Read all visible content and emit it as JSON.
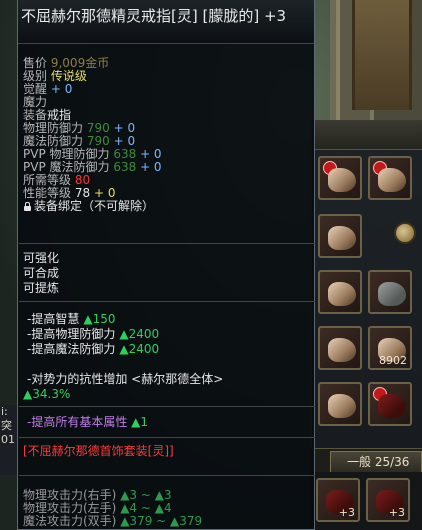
{
  "background": {
    "left_strip_text": [
      "i:",
      "突",
      "01"
    ]
  },
  "tooltip": {
    "title": "不屈赫尔那德精灵戒指[灵] [朦胧的] +3",
    "price_label": "售价",
    "price_value": "9,009金币",
    "level_label": "级别",
    "level_value": "传说级",
    "awaken_label": "觉醒",
    "awaken_value": "+ 0",
    "magic_label": "魔力",
    "equip_label": "装备",
    "equip_value": "戒指",
    "phys_def_label": "物理防御力",
    "phys_def_value": "790",
    "phys_def_plus": "+ 0",
    "mag_def_label": "魔法防御力",
    "mag_def_value": "790",
    "mag_def_plus": "+ 0",
    "pvp_phys_label": "PVP 物理防御力",
    "pvp_phys_value": "638",
    "pvp_phys_plus": "+ 0",
    "pvp_mag_label": "PVP 魔法防御力",
    "pvp_mag_value": "638",
    "pvp_mag_plus": "+ 0",
    "req_level_label": "所需等级",
    "req_level_value": "80",
    "perf_level_label": "性能等级",
    "perf_level_value": "78",
    "perf_level_plus": "+ 0",
    "bind_text": "装备绑定（不可解除）",
    "enhance": [
      "可强化",
      "可合成",
      "可提炼"
    ],
    "options": [
      {
        "label": "-提高智慧",
        "value": "▲150"
      },
      {
        "label": "-提高物理防御力",
        "value": "▲2400"
      },
      {
        "label": "-提高魔法防御力",
        "value": "▲2400"
      }
    ],
    "resist_label": "-对势力的抗性增加 <赫尔那德全体>",
    "resist_value": "▲34.3%",
    "all_attr_label": "-提高所有基本属性",
    "all_attr_value": "▲1",
    "set_name": "[不屈赫尔那德首饰套装[灵]]",
    "set_rows": [
      {
        "label": "物理攻击力(右手)",
        "value": "▲3 ~ ▲3"
      },
      {
        "label": "物理攻击力(左手)",
        "value": "▲4 ~ ▲4"
      },
      {
        "label": "魔法攻击力(双手)",
        "value": "▲379 ~ ▲379"
      }
    ]
  },
  "inventory": {
    "slot_labels": [
      "8902",
      "+3",
      "+3"
    ],
    "tab_label": "一般 25/36"
  },
  "colors": {
    "legend_green": "#2fcf5c",
    "set_red": "#ff3a3a",
    "level_yellow": "#e6df5a",
    "awaken_blue": "#7cb6ff"
  }
}
